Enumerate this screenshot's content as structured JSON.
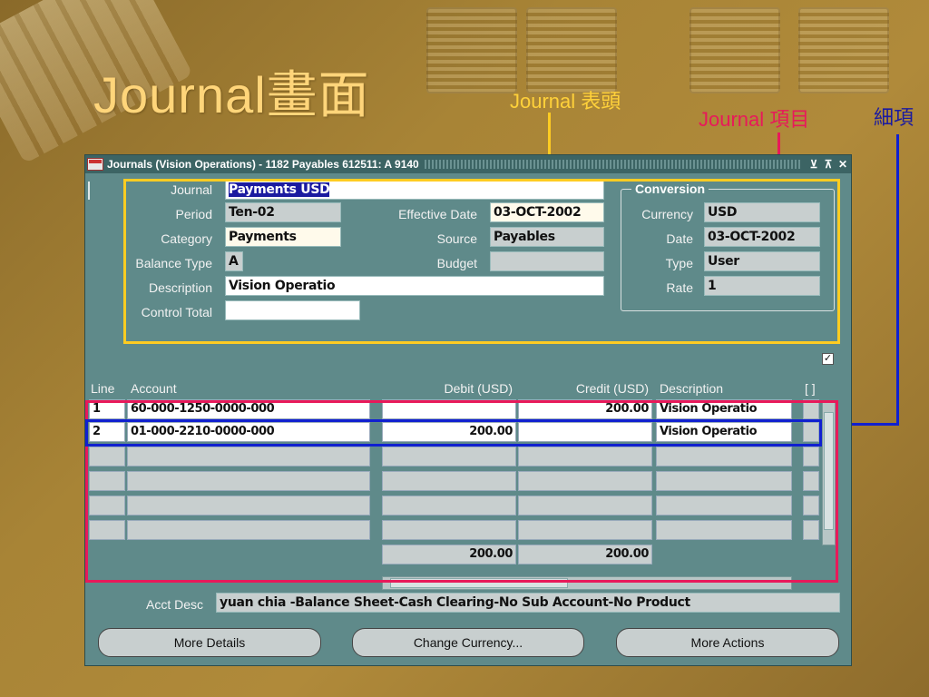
{
  "slide": {
    "title": "Journal畫面",
    "callouts": {
      "header": "Journal 表頭",
      "lines": "Journal 項目",
      "detail": "細項"
    },
    "colors": {
      "header": "#ffcc22",
      "lines": "#e8195a",
      "detail": "#1020d0"
    }
  },
  "window": {
    "title": "Journals (Vision Operations) - 1182 Payables 612511: A 9140",
    "controls": [
      "⊻",
      "⊼",
      "✕"
    ]
  },
  "header": {
    "journal": {
      "label": "Journal",
      "value": "Payments USD"
    },
    "period": {
      "label": "Period",
      "value": "Ten-02"
    },
    "category": {
      "label": "Category",
      "value": "Payments"
    },
    "balance_type": {
      "label": "Balance Type",
      "value": "A"
    },
    "description": {
      "label": "Description",
      "value": "Vision Operatio"
    },
    "control_total": {
      "label": "Control Total",
      "value": ""
    },
    "effective_date": {
      "label": "Effective Date",
      "value": "03-OCT-2002"
    },
    "source": {
      "label": "Source",
      "value": "Payables"
    },
    "budget": {
      "label": "Budget",
      "value": ""
    }
  },
  "conversion": {
    "title": "Conversion",
    "currency": {
      "label": "Currency",
      "value": "USD"
    },
    "date": {
      "label": "Date",
      "value": "03-OCT-2002"
    },
    "type": {
      "label": "Type",
      "value": "User"
    },
    "rate": {
      "label": "Rate",
      "value": "1"
    }
  },
  "lines": {
    "columns": {
      "line": "Line",
      "account": "Account",
      "debit": "Debit (USD)",
      "credit": "Credit (USD)",
      "description": "Description",
      "flex": "[ ]"
    },
    "rows": [
      {
        "line": "1",
        "account": "60-000-1250-0000-000",
        "debit": "",
        "credit": "200.00",
        "description": "Vision Operatio"
      },
      {
        "line": "2",
        "account": "01-000-2210-0000-000",
        "debit": "200.00",
        "credit": "",
        "description": "Vision Operatio"
      },
      {
        "line": "",
        "account": "",
        "debit": "",
        "credit": "",
        "description": ""
      },
      {
        "line": "",
        "account": "",
        "debit": "",
        "credit": "",
        "description": ""
      },
      {
        "line": "",
        "account": "",
        "debit": "",
        "credit": "",
        "description": ""
      },
      {
        "line": "",
        "account": "",
        "debit": "",
        "credit": "",
        "description": ""
      }
    ],
    "totals": {
      "debit": "200.00",
      "credit": "200.00"
    }
  },
  "acct_desc": {
    "label": "Acct Desc",
    "value": "yuan chia -Balance Sheet-Cash Clearing-No Sub Account-No Product"
  },
  "buttons": {
    "more_details": "More Details",
    "change_currency": "Change Currency...",
    "more_actions": "More Actions"
  }
}
